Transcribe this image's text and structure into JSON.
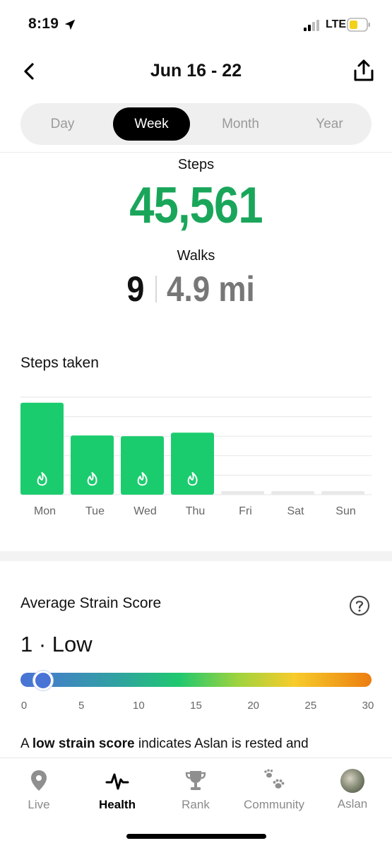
{
  "status_bar": {
    "time": "8:19",
    "network": "LTE"
  },
  "header": {
    "title": "Jun 16 - 22"
  },
  "tabs_period": [
    {
      "label": "Day",
      "active": false
    },
    {
      "label": "Week",
      "active": true
    },
    {
      "label": "Month",
      "active": false
    },
    {
      "label": "Year",
      "active": false
    }
  ],
  "summary": {
    "steps_label": "Steps",
    "steps_value": "45,561",
    "walks_label": "Walks",
    "walks_count": "9",
    "walks_distance": "4.9 mi"
  },
  "chart_data": {
    "type": "bar",
    "title": "Steps taken",
    "categories": [
      "Mon",
      "Tue",
      "Wed",
      "Thu",
      "Fri",
      "Sat",
      "Sun"
    ],
    "values": [
      13200,
      8500,
      8400,
      8900,
      0,
      0,
      0
    ],
    "ylim": [
      0,
      14000
    ],
    "grid": true,
    "bar_icon": "flame-icon",
    "colors": {
      "bar": "#1bcc6e",
      "empty": "#e8e8e8",
      "grid": "#e6e6e6"
    }
  },
  "strain": {
    "title": "Average Strain Score",
    "score_text": "1 · Low",
    "score_value": 1,
    "scale_max": 30,
    "ticks": [
      "0",
      "5",
      "10",
      "15",
      "20",
      "25",
      "30"
    ],
    "desc_prefix": "A ",
    "desc_bold": "low strain score",
    "desc_suffix": " indicates Aslan is rested and"
  },
  "tab_bar": [
    {
      "label": "Live",
      "icon": "location-pin-icon",
      "active": false
    },
    {
      "label": "Health",
      "icon": "pulse-icon",
      "active": true
    },
    {
      "label": "Rank",
      "icon": "trophy-icon",
      "active": false
    },
    {
      "label": "Community",
      "icon": "paw-prints-icon",
      "active": false
    },
    {
      "label": "Aslan",
      "icon": "avatar",
      "active": false
    }
  ],
  "colors": {
    "accent_green": "#1aa65a",
    "active_segment": "#000000",
    "muted_text": "#9a9a9a"
  }
}
